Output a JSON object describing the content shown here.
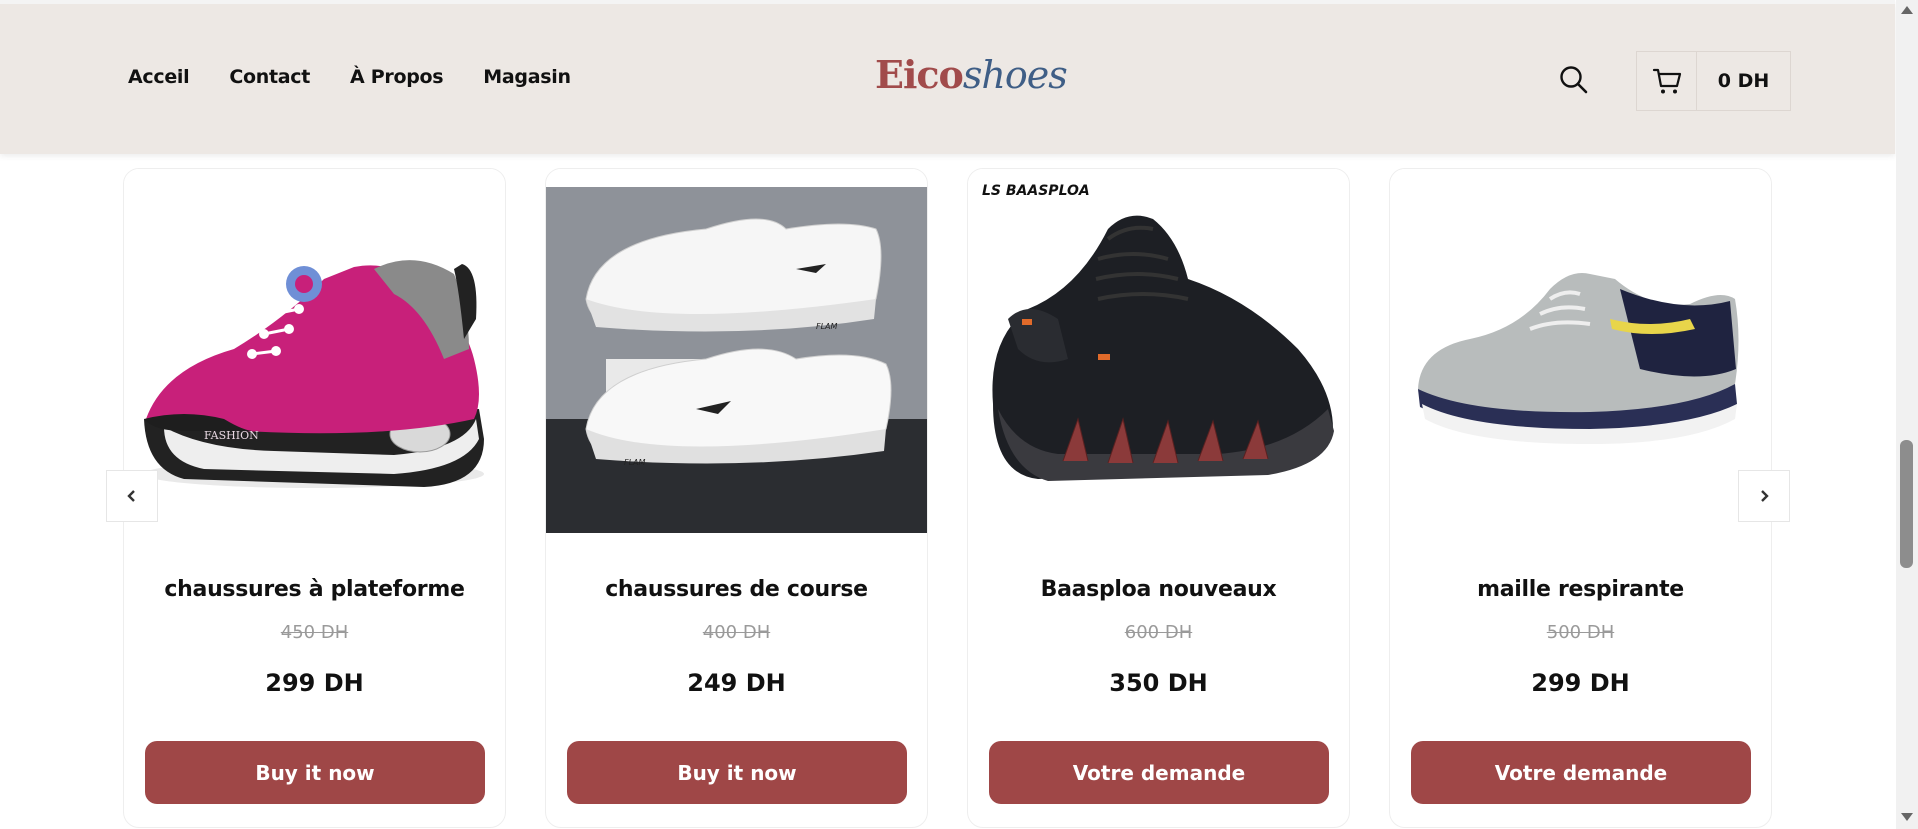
{
  "header": {
    "nav": [
      "Acceil",
      "Contact",
      "À Propos",
      "Magasin"
    ],
    "logo_part1": "Eico",
    "logo_part2": "shoes",
    "cart_total": "0 DH"
  },
  "colors": {
    "accent": "#9f4747",
    "header_bg": "#ede8e4",
    "logo_red": "#a14b4b",
    "logo_blue": "#3f5e86"
  },
  "products": [
    {
      "title": "chaussures à plateforme",
      "old_price": "450 DH",
      "price": "299 DH",
      "button": "Buy it now",
      "image": "pink-platform-sneaker"
    },
    {
      "title": "chaussures de course",
      "old_price": "400 DH",
      "price": "249 DH",
      "button": "Buy it now",
      "image": "white-running-shoes"
    },
    {
      "title": "Baasploa nouveaux",
      "old_price": "600 DH",
      "price": "350 DH",
      "button": "Votre demande",
      "image": "black-baasploa-sneaker",
      "brand_text": "BAASPLOA"
    },
    {
      "title": "maille respirante",
      "old_price": "500 DH",
      "price": "299 DH",
      "button": "Votre demande",
      "image": "grey-mesh-sneaker"
    }
  ]
}
